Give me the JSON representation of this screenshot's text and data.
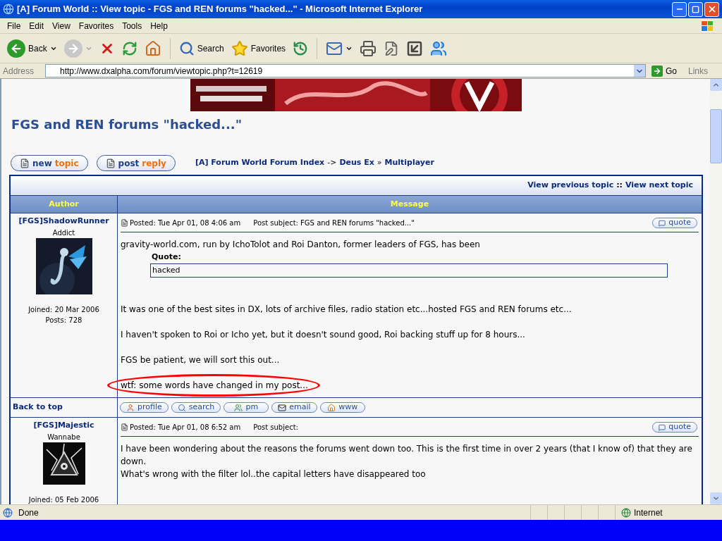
{
  "window": {
    "title": "[A] Forum World :: View topic - FGS and REN forums \"hacked...\" - Microsoft Internet Explorer"
  },
  "menu": [
    "File",
    "Edit",
    "View",
    "Favorites",
    "Tools",
    "Help"
  ],
  "toolbar": [
    {
      "kind": "back",
      "label": "Back",
      "disabled": false,
      "dropdown": true
    },
    {
      "kind": "forward",
      "disabled": true,
      "dropdown": true
    },
    {
      "kind": "stop",
      "disabled": false
    },
    {
      "kind": "refresh",
      "disabled": false
    },
    {
      "kind": "home",
      "disabled": false
    },
    {
      "kind": "search",
      "label": "Search",
      "disabled": false
    },
    {
      "kind": "favorites",
      "label": "Favorites",
      "disabled": false
    },
    {
      "kind": "history",
      "disabled": false
    },
    {
      "kind": "mail",
      "disabled": false,
      "dropdown": true
    },
    {
      "kind": "print",
      "disabled": false
    },
    {
      "kind": "edit",
      "disabled": false
    },
    {
      "kind": "app",
      "disabled": false
    },
    {
      "kind": "messenger",
      "disabled": false
    }
  ],
  "address": {
    "label": "Address",
    "url": "http://www.dxalpha.com/forum/viewtopic.php?t=12619",
    "go": "Go",
    "links": "Links"
  },
  "page": {
    "banner": {
      "kind": "picture"
    },
    "topic_title": "FGS and REN forums \"hacked...\"",
    "buttons": [
      {
        "first": "new",
        "second": "topic"
      },
      {
        "first": "post",
        "second": "reply"
      }
    ],
    "breadcrumb": [
      {
        "kind": "link",
        "text": "[A] Forum World Forum Index"
      },
      {
        "kind": "sep",
        "text": "->"
      },
      {
        "kind": "link",
        "text": "Deus Ex"
      },
      {
        "kind": "sep",
        "text": "»"
      },
      {
        "kind": "link",
        "text": "Multiplayer"
      }
    ],
    "topic_nav": [
      {
        "kind": "link",
        "text": "View previous topic"
      },
      {
        "kind": "sep",
        "text": "::"
      },
      {
        "kind": "link",
        "text": "View next topic"
      }
    ],
    "columns": [
      "Author",
      "Message"
    ],
    "posts": [
      {
        "author": "[FGS]ShadowRunner",
        "rank": "Addict",
        "joined": "Joined: 20 Mar 2006",
        "count": "Posts: 728",
        "posted": "Posted: Tue Apr 01, 08 4:06 am",
        "subject": "Post subject: FGS and REN forums \"hacked...\"",
        "quote_button": "quote",
        "body": [
          {
            "kind": "paragraph",
            "text": "gravity-world.com, run by IchoTolot and Roi Danton, former leaders of FGS, has been",
            "circled": false
          },
          {
            "kind": "quote",
            "label": "Quote:",
            "text": "hacked"
          },
          {
            "kind": "paragraph",
            "text": "It was one of the best sites in DX, lots of archive files, radio station etc...hosted FGS and REN forums etc...",
            "circled": false
          },
          {
            "kind": "paragraph",
            "text": "I haven't spoken to Roi or Icho yet, but it doesn't sound good, Roi backing stuff up for 8 hours...",
            "circled": false
          },
          {
            "kind": "paragraph",
            "text": "FGS be patient, we will sort this out...",
            "circled": false
          },
          {
            "kind": "paragraph",
            "text": "wtf: some words have changed in my post...",
            "circled": true
          }
        ],
        "footer": {
          "back_to_top": "Back to top",
          "buttons": [
            {
              "kind": "profile",
              "label": "profile"
            },
            {
              "kind": "search",
              "label": "search"
            },
            {
              "kind": "pm",
              "label": "pm"
            },
            {
              "kind": "email",
              "label": "email"
            },
            {
              "kind": "www",
              "label": "www"
            }
          ]
        }
      },
      {
        "author": "[FGS]Majestic",
        "rank": "Wannabe",
        "joined": "Joined: 05 Feb 2006",
        "posted": "Posted: Tue Apr 01, 08 6:52 am",
        "subject": "Post subject:",
        "quote_button": "quote",
        "body": [
          {
            "kind": "line",
            "text": "I have been wondering about the reasons the forums went down too. This is the first time in over 2 years (that I know of) that they are down.",
            "circled": false
          },
          {
            "kind": "line",
            "text": "What's wrong with the filter lol..the capital letters have disappeared too",
            "circled": false
          }
        ]
      }
    ]
  },
  "status_bar": {
    "text": "Done",
    "zone": "Internet"
  }
}
